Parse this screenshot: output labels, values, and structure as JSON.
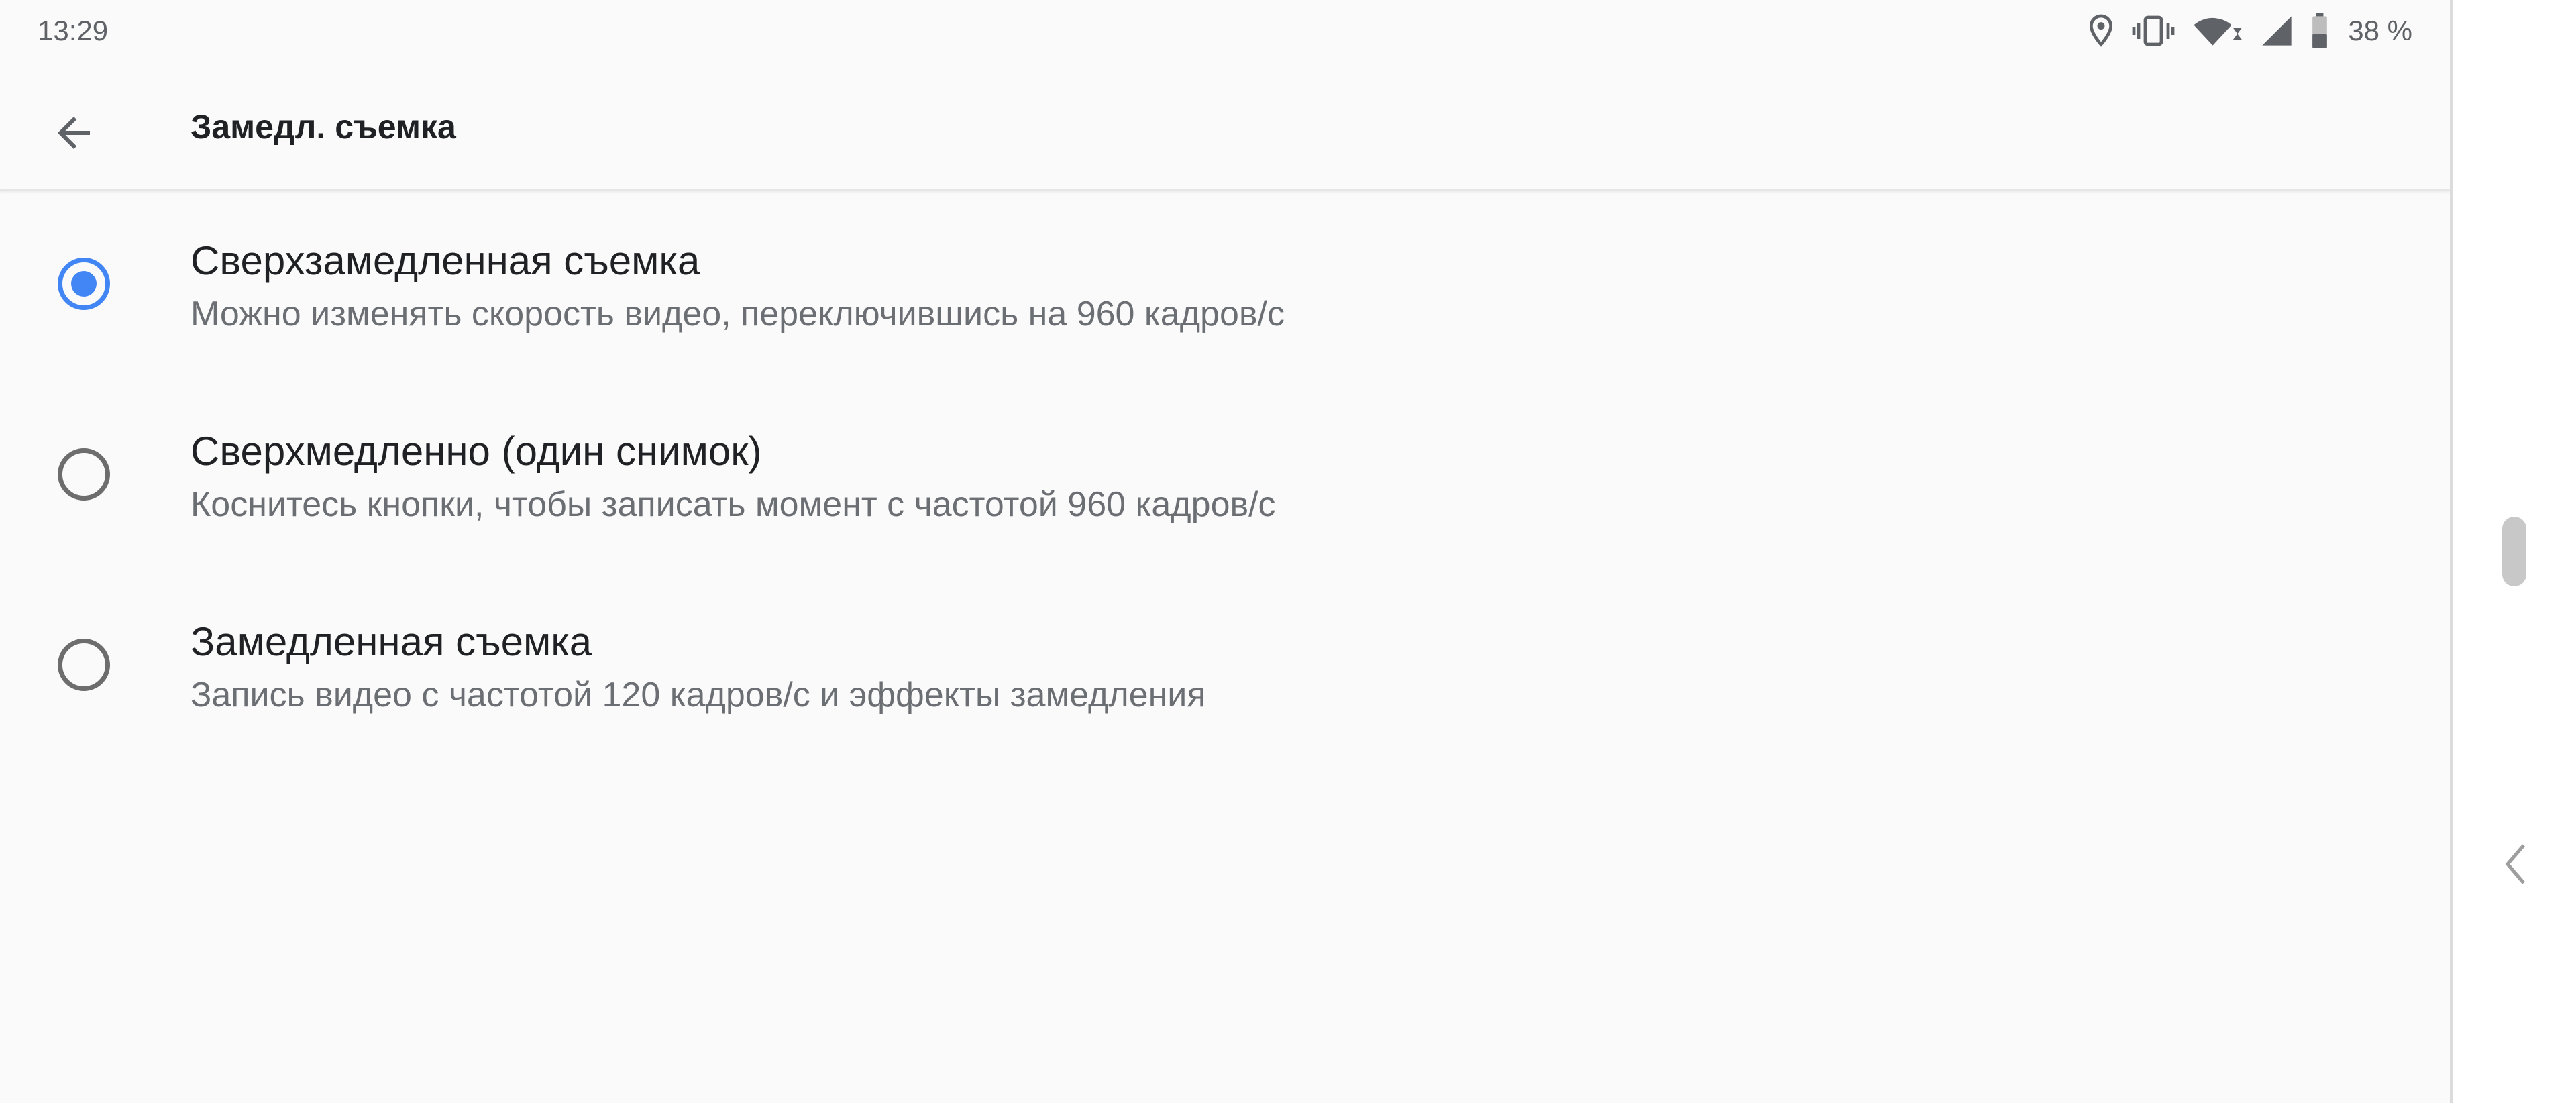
{
  "status_bar": {
    "time": "13:29",
    "battery_text": "38 %",
    "icons": [
      "location-icon",
      "vibrate-icon",
      "wifi-icon",
      "signal-icon",
      "battery-icon"
    ]
  },
  "toolbar": {
    "title": "Замедл. съемка",
    "back_icon": "arrow-back-icon"
  },
  "options": [
    {
      "title": "Сверхзамедленная съемка",
      "subtitle": "Можно изменять скорость видео, переключившись на 960 кадров/с",
      "selected": true
    },
    {
      "title": "Сверхмедленно (один снимок)",
      "subtitle": "Коснитесь кнопки, чтобы записать момент с частотой 960 кадров/с",
      "selected": false
    },
    {
      "title": "Замедленная съемка",
      "subtitle": "Запись видео с частотой 120 кадров/с и эффекты замедления",
      "selected": false
    }
  ],
  "colors": {
    "accent": "#4285f4",
    "background": "#fafafa",
    "title_text": "#202124",
    "subtitle_text": "#6b6f73"
  }
}
